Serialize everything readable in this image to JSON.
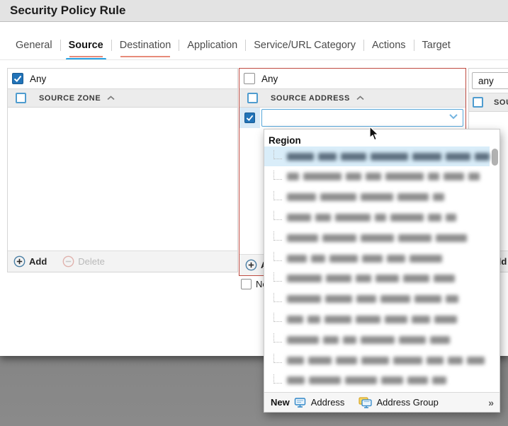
{
  "window": {
    "title": "Security Policy Rule"
  },
  "tabs": {
    "general": "General",
    "source": "Source",
    "destination": "Destination",
    "application": "Application",
    "service_url": "Service/URL Category",
    "actions": "Actions",
    "target": "Target"
  },
  "zone_panel": {
    "any_label": "Any",
    "any_checked": true,
    "header": "SOURCE ZONE",
    "add": "Add",
    "delete": "Delete"
  },
  "address_panel": {
    "any_label": "Any",
    "any_checked": false,
    "header": "SOURCE ADDRESS",
    "combobox_value": "",
    "add": "Add",
    "negate": "Negate"
  },
  "user_panel": {
    "select_value": "any",
    "header": "SOURCE USER",
    "add": "Add"
  },
  "region_dropdown": {
    "group_label": "Region",
    "redacted_rows": 13,
    "footer": {
      "new": "New",
      "address": "Address",
      "address_group": "Address Group",
      "more": "»"
    }
  },
  "colors": {
    "accent_blue": "#2aa2e2",
    "error_red": "#bf4a40",
    "checkbox_blue": "#2173b8",
    "selection_blue": "#d9edf9"
  }
}
